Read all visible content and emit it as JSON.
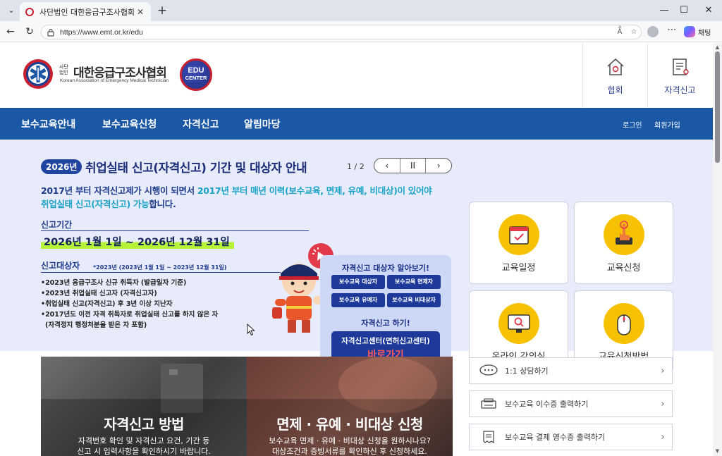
{
  "browser": {
    "tab_title": "사단법인 대한응급구조사협회",
    "url": "https://www.emt.or.kr/edu",
    "copilot_label": "채팅",
    "tab_close": "✕",
    "new_tab": "+",
    "window_minimize": "—",
    "window_maximize": "☐",
    "window_close": "✕",
    "tab_list": "⌄",
    "back": "←",
    "reload": "↻",
    "read_aloud": "Aͣ",
    "favorite": "☆",
    "more": "⋯"
  },
  "header": {
    "org_small_1": "사단",
    "org_small_2": "법인",
    "org_name": "대한응급구조사협회",
    "org_english": "Korean Association of Emergency Medical Technician",
    "edu_badge_1": "EDU",
    "edu_badge_2": "CENTER",
    "quicklinks": [
      {
        "label": "협회",
        "icon": "house-icon"
      },
      {
        "label": "자격신고",
        "icon": "certificate-icon"
      }
    ]
  },
  "nav": {
    "items": [
      "보수교육안내",
      "보수교육신청",
      "자격신고",
      "알림마당"
    ],
    "login": "로그인",
    "signup": "회원가입"
  },
  "hero": {
    "year_pill": "2026년",
    "title": "취업실태 신고(자격신고) 기간 및 대상자 안내",
    "pager": "1 / 2",
    "ctrl_prev": "‹",
    "ctrl_pause": "II",
    "ctrl_next": "›",
    "line1_a": "2017년 부터 자격신고제가 시행이 되면서 ",
    "line1_b": "2017년 부터 매년 이력(보수교육, 면제, 유예, 비대상)이 있어야",
    "line2_a": "취업실태 신고(자격신고) 가능",
    "line2_b": "합니다.",
    "period_head": "신고기간",
    "period": "2026년 1월 1일 ~ 2026년 12월 31일",
    "target_head": "신고대상자",
    "target_sub": "*2023년 (2023년 1월 1일 ~ 2023년 12월 31일)",
    "bullets": [
      "•2023년 응급구조사 신규 취득자 (발급일자 기준)",
      "•2023년 취업실태 신고자 (자격신고자)",
      "•취업실태 신고(자격신고) 후 3년 이상 지난자",
      "•2017년도 이전 자격 취득자로 취업실태 신고를 하지 않은 자",
      "  (자격정지 행정처분을 받은 자 포함)"
    ],
    "promo": {
      "head": "자격신고 대상자 알아보기!",
      "chips": [
        "보수교육 대상자",
        "보수교육 면제자",
        "보수교육 유예자",
        "보수교육 비대상자"
      ],
      "head2": "자격신고 하기!",
      "cta_1": "자격신고센터(면허신고센터)",
      "cta_2": "바로가기"
    }
  },
  "cards": [
    {
      "label": "교육일정",
      "icon": "calendar-icon"
    },
    {
      "label": "교육신청",
      "icon": "tap-hand-icon"
    },
    {
      "label": "온라인 강의실",
      "icon": "monitor-search-icon"
    },
    {
      "label": "교육신청방법",
      "icon": "mouse-icon"
    }
  ],
  "banners": [
    {
      "title": "자격신고 방법",
      "sub_1": "자격번호 확인 및 자격신고 요건, 기간 등",
      "sub_2": "신고 시 입력사항을 확인하시기 바랍니다."
    },
    {
      "title": "면제 · 유예 · 비대상 신청",
      "sub_1": "보수교육 면제 · 유예 · 비대상 신청을 원하시나요?",
      "sub_2": "대상조건과 증빙서류를 확인하신 후 신청하세요."
    }
  ],
  "links": [
    {
      "label": "1:1 상담하기",
      "icon": "chat-bubble-icon"
    },
    {
      "label": "보수교육 이수증 출력하기",
      "icon": "printer-icon"
    },
    {
      "label": "보수교육 결제 영수증 출력하기",
      "icon": "receipt-icon"
    }
  ],
  "link_arrow": "›",
  "colors": {
    "nav_blue": "#1a58a6",
    "hero_bg": "#e8ecfa",
    "accent_red": "#c8202f",
    "highlight_cyan": "#1aa2c8",
    "card_icon_yellow": "#f6c200"
  }
}
